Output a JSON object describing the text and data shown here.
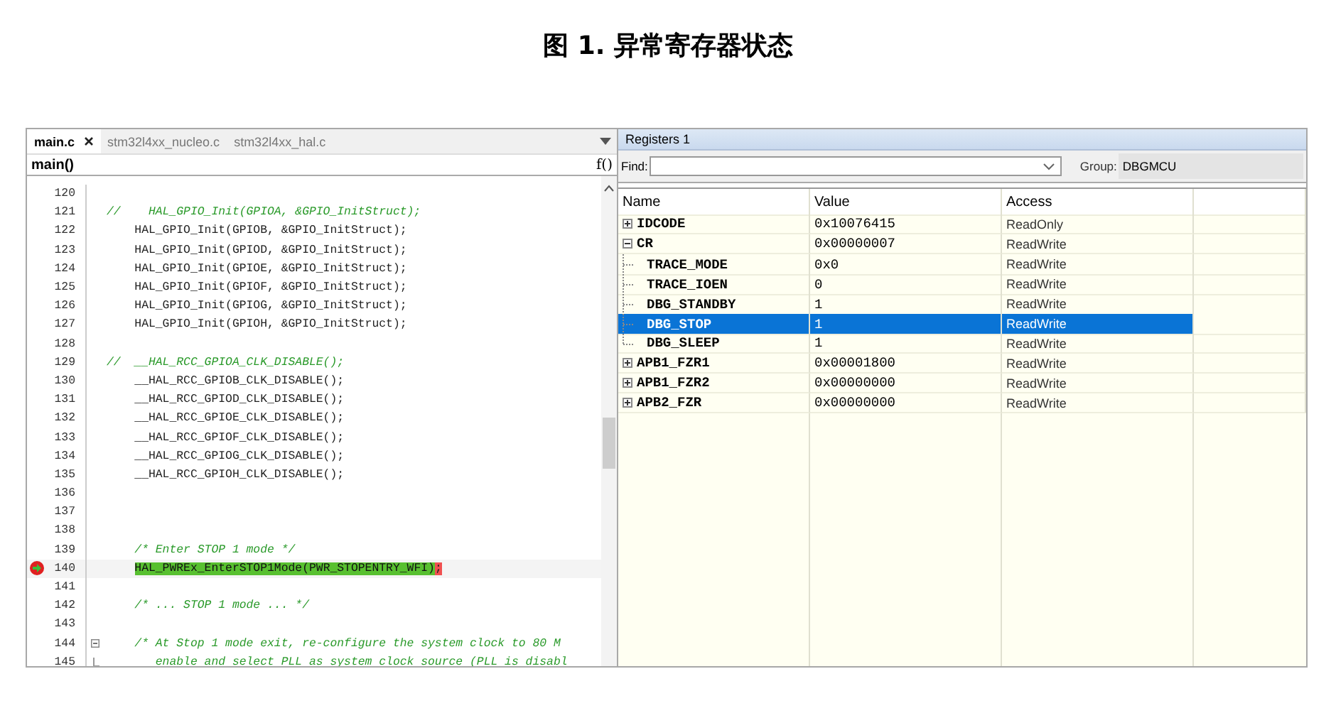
{
  "figure_title": "图 1. 异常寄存器状态",
  "editor": {
    "tabs": [
      {
        "label": "main.c",
        "selected": true,
        "closable": true
      },
      {
        "label": "stm32l4xx_nucleo.c",
        "selected": false,
        "closable": false
      },
      {
        "label": "stm32l4xx_hal.c",
        "selected": false,
        "closable": false
      }
    ],
    "function_bar": "main()",
    "function_icon": "f()",
    "lines": [
      {
        "number": "120",
        "kind": "code"
      },
      {
        "number": "121",
        "text": "//    HAL_GPIO_Init(GPIOA, &GPIO_InitStruct);",
        "kind": "comment"
      },
      {
        "number": "122",
        "text": "    HAL_GPIO_Init(GPIOB, &GPIO_InitStruct);",
        "kind": "code"
      },
      {
        "number": "123",
        "text": "    HAL_GPIO_Init(GPIOD, &GPIO_InitStruct);",
        "kind": "code"
      },
      {
        "number": "124",
        "text": "    HAL_GPIO_Init(GPIOE, &GPIO_InitStruct);",
        "kind": "code"
      },
      {
        "number": "125",
        "text": "    HAL_GPIO_Init(GPIOF, &GPIO_InitStruct);",
        "kind": "code"
      },
      {
        "number": "126",
        "text": "    HAL_GPIO_Init(GPIOG, &GPIO_InitStruct);",
        "kind": "code"
      },
      {
        "number": "127",
        "text": "    HAL_GPIO_Init(GPIOH, &GPIO_InitStruct);",
        "kind": "code"
      },
      {
        "number": "128",
        "kind": "code"
      },
      {
        "number": "129",
        "text": "//  __HAL_RCC_GPIOA_CLK_DISABLE();",
        "kind": "comment"
      },
      {
        "number": "130",
        "text": "    __HAL_RCC_GPIOB_CLK_DISABLE();",
        "kind": "code"
      },
      {
        "number": "131",
        "text": "    __HAL_RCC_GPIOD_CLK_DISABLE();",
        "kind": "code"
      },
      {
        "number": "132",
        "text": "    __HAL_RCC_GPIOE_CLK_DISABLE();",
        "kind": "code"
      },
      {
        "number": "133",
        "text": "    __HAL_RCC_GPIOF_CLK_DISABLE();",
        "kind": "code"
      },
      {
        "number": "134",
        "text": "    __HAL_RCC_GPIOG_CLK_DISABLE();",
        "kind": "code"
      },
      {
        "number": "135",
        "text": "    __HAL_RCC_GPIOH_CLK_DISABLE();",
        "kind": "code"
      },
      {
        "number": "136",
        "kind": "code"
      },
      {
        "number": "137",
        "kind": "code"
      },
      {
        "number": "138",
        "kind": "code"
      },
      {
        "number": "139",
        "text": "    /* Enter STOP 1 mode */",
        "kind": "comment"
      },
      {
        "number": "140",
        "text": "HAL_PWREx_EnterSTOP1Mode(PWR_STOPENTRY_WFI)",
        "tail": ";",
        "kind": "current"
      },
      {
        "number": "141",
        "kind": "code"
      },
      {
        "number": "142",
        "text": "    /* ... STOP 1 mode ... */",
        "kind": "comment"
      },
      {
        "number": "143",
        "kind": "code"
      },
      {
        "number": "144",
        "text": "    /* At Stop 1 mode exit, re-configure the system clock to 80 M",
        "kind": "comment",
        "fold_start": true
      },
      {
        "number": "145",
        "text": "       enable and select PLL as system clock source (PLL is disabl",
        "kind": "comment",
        "fold_end": true
      }
    ]
  },
  "registers": {
    "title": "Registers 1",
    "find_label": "Find:",
    "group_label": "Group:",
    "group_value": "DBGMCU",
    "columns": [
      "Name",
      "Value",
      "Access"
    ],
    "rows": [
      {
        "name": "IDCODE",
        "value": "0x10076415",
        "access": "ReadOnly",
        "expanded": false,
        "selected": false
      },
      {
        "name": "CR",
        "value": "0x00000007",
        "access": "ReadWrite",
        "expanded": true,
        "selected": false,
        "children": [
          {
            "name": "TRACE_MODE",
            "value": "0x0",
            "access": "ReadWrite",
            "selected": false
          },
          {
            "name": "TRACE_IOEN",
            "value": "0",
            "access": "ReadWrite",
            "selected": false
          },
          {
            "name": "DBG_STANDBY",
            "value": "1",
            "access": "ReadWrite",
            "selected": false
          },
          {
            "name": "DBG_STOP",
            "value": "1",
            "access": "ReadWrite",
            "selected": true
          },
          {
            "name": "DBG_SLEEP",
            "value": "1",
            "access": "ReadWrite",
            "selected": false
          }
        ]
      },
      {
        "name": "APB1_FZR1",
        "value": "0x00001800",
        "access": "ReadWrite",
        "expanded": false,
        "selected": false
      },
      {
        "name": "APB1_FZR2",
        "value": "0x00000000",
        "access": "ReadWrite",
        "expanded": false,
        "selected": false
      },
      {
        "name": "APB2_FZR",
        "value": "0x00000000",
        "access": "ReadWrite",
        "expanded": false,
        "selected": false
      }
    ]
  }
}
